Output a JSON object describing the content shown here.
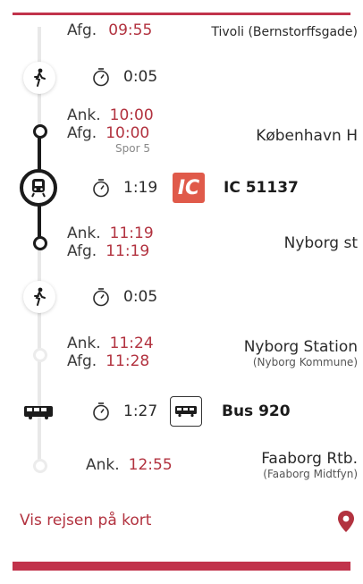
{
  "top_row": {
    "label": "Afg.",
    "time": "09:55",
    "place": "Tivoli (Bernstorffsgade)"
  },
  "walk1": {
    "duration": "0:05",
    "icon": "walk-icon"
  },
  "stop_kbh": {
    "arr_label": "Ank.",
    "arr_time": "10:00",
    "dep_label": "Afg.",
    "dep_time": "10:00",
    "track": "Spor 5",
    "place": "København H"
  },
  "train_leg": {
    "duration": "1:19",
    "badge": "IC",
    "name": "IC 51137",
    "icon": "train-icon",
    "badge_color": "#e05a4a"
  },
  "stop_nyborg_st": {
    "arr_label": "Ank.",
    "arr_time": "11:19",
    "dep_label": "Afg.",
    "dep_time": "11:19",
    "place": "Nyborg st"
  },
  "walk2": {
    "duration": "0:05",
    "icon": "walk-icon"
  },
  "stop_nyborg_station": {
    "arr_label": "Ank.",
    "arr_time": "11:24",
    "dep_label": "Afg.",
    "dep_time": "11:28",
    "place": "Nyborg Station",
    "sub": "(Nyborg Kommune)"
  },
  "bus_leg": {
    "duration": "1:27",
    "name": "Bus 920",
    "icon": "bus-icon"
  },
  "stop_faaborg": {
    "arr_label": "Ank.",
    "arr_time": "12:55",
    "place": "Faaborg Rtb.",
    "sub": "(Faaborg Midtfyn)"
  },
  "map_link": {
    "label": "Vis rejsen på kort",
    "icon": "map-pin-icon"
  },
  "colors": {
    "accent": "#b2323f",
    "rule": "#c1334b"
  }
}
